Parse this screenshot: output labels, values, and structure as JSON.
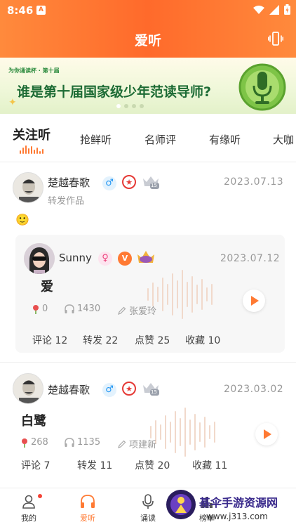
{
  "status_bar": {
    "time": "8:46",
    "notif_letter": "A"
  },
  "header": {
    "title": "爱听"
  },
  "banner": {
    "small_text": "为你诵读杯 · 第十届",
    "headline": "谁是第十届国家级少年范读导师?"
  },
  "tabs": [
    {
      "label": "关注听",
      "active": true
    },
    {
      "label": "抢鲜听"
    },
    {
      "label": "名师评"
    },
    {
      "label": "有缘听"
    },
    {
      "label": "大咖"
    }
  ],
  "posts": [
    {
      "user": "楚越春歌",
      "sub": "转发作品",
      "date": "2023.07.13",
      "emoji": "🙂",
      "level": "15",
      "forward": {
        "user": "Sunny",
        "date": "2023.07.12",
        "title": "爱",
        "flowers": "0",
        "listens": "1430",
        "author": "张爱玲",
        "actions": {
          "comment": "评论 12",
          "forward": "转发 22",
          "like": "点赞 25",
          "collect": "收藏 10"
        }
      }
    },
    {
      "user": "楚越春歌",
      "date": "2023.03.02",
      "level": "15",
      "title": "白鹭",
      "flowers": "268",
      "listens": "1135",
      "author": "项建新",
      "actions": {
        "comment": "评论 7",
        "forward": "转发 11",
        "like": "点赞 20",
        "collect": "收藏 11"
      }
    }
  ],
  "bottom_nav": [
    {
      "label": "我的",
      "icon": "person-icon"
    },
    {
      "label": "爱听",
      "icon": "headphones-icon",
      "active": true
    },
    {
      "label": "诵读",
      "icon": "microphone-icon"
    },
    {
      "label": "榜单",
      "icon": "chart-icon"
    }
  ],
  "watermark": {
    "name": "基伞手游资源网",
    "url": "www.j313.com"
  },
  "colors": {
    "accent": "#ff7a33",
    "header": "#ff6a2b"
  }
}
